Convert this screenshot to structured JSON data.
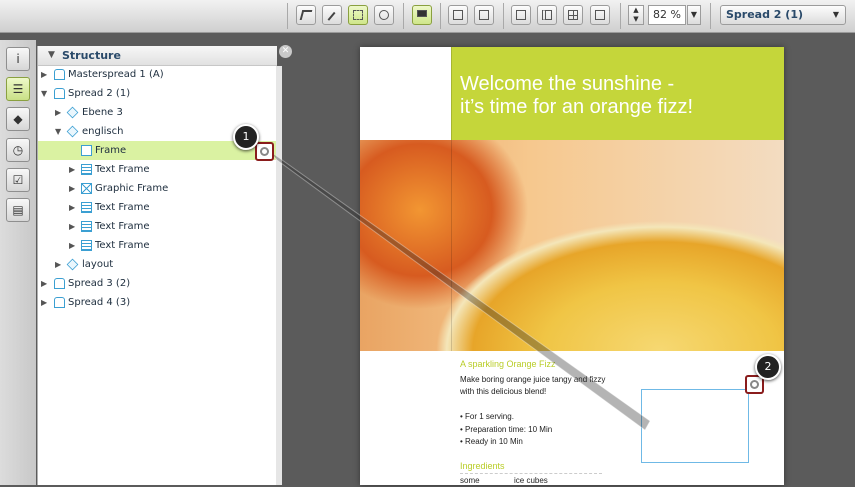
{
  "toolbar": {
    "zoom_value": "82 %",
    "spread_select": "Spread 2 (1)",
    "dropdown_glyph": "▼"
  },
  "panel": {
    "title": "Structure",
    "close_glyph": "✕",
    "rows": [
      {
        "label": "Masterspread 1 (A)"
      },
      {
        "label": "Spread 2 (1)"
      },
      {
        "label": "Ebene 3"
      },
      {
        "label": "englisch"
      },
      {
        "label": "Frame"
      },
      {
        "label": "Text Frame"
      },
      {
        "label": "Graphic Frame"
      },
      {
        "label": "Text Frame"
      },
      {
        "label": "Text Frame"
      },
      {
        "label": "Text Frame"
      },
      {
        "label": "layout"
      },
      {
        "label": "Spread 3 (2)"
      },
      {
        "label": "Spread 4 (3)"
      }
    ]
  },
  "callouts": {
    "one": "1",
    "two": "2"
  },
  "document": {
    "title_line1": "Welcome the sunshine -",
    "title_line2": "it’s time for an orange fizz!",
    "subtitle": "A sparkling Orange Fizz",
    "intro1": "Make boring orange juice tangy and fizzy",
    "intro2": "with this delicious blend!",
    "bullet1": "• For 1 serving.",
    "bullet2": "• Preparation time: 10 Min",
    "bullet3": "• Ready in 10 Min",
    "ingredients": "Ingredients",
    "ing_a": "some",
    "ing_b": "ice cubes"
  },
  "colors": {
    "accent": "#c5d63a",
    "selection": "#daf2a2",
    "frame_blue": "#3b9fd2",
    "callout_border": "#8a1c1c"
  },
  "icons": [
    "select-tool-icon",
    "pen-icon",
    "frame-tool-icon",
    "search-icon",
    "comment-icon",
    "image-icon",
    "layout-icon",
    "info-icon",
    "structure-icon",
    "layers-icon",
    "history-icon",
    "checklist-icon",
    "notes-icon",
    "visibility-icon"
  ]
}
